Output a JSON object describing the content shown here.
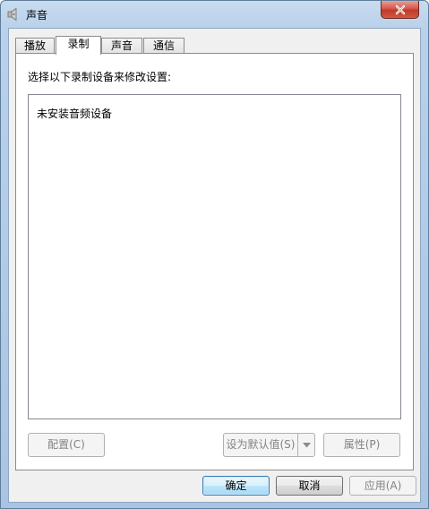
{
  "window": {
    "title": "声音",
    "icon": "speaker-icon",
    "close_label": "×"
  },
  "tabs": [
    {
      "label": "播放",
      "active": false
    },
    {
      "label": "录制",
      "active": true
    },
    {
      "label": "声音",
      "active": false
    },
    {
      "label": "通信",
      "active": false
    }
  ],
  "panel": {
    "instruction": "选择以下录制设备来修改设置:",
    "empty_message": "未安装音频设备"
  },
  "buttons": {
    "configure": "配置(C)",
    "set_default": "设为默认值(S)",
    "properties": "属性(P)",
    "ok": "确定",
    "cancel": "取消",
    "apply": "应用(A)"
  },
  "colors": {
    "close_button": "#c0392b",
    "focus_button_border": "#3c7fb1",
    "disabled_text": "#838383"
  }
}
